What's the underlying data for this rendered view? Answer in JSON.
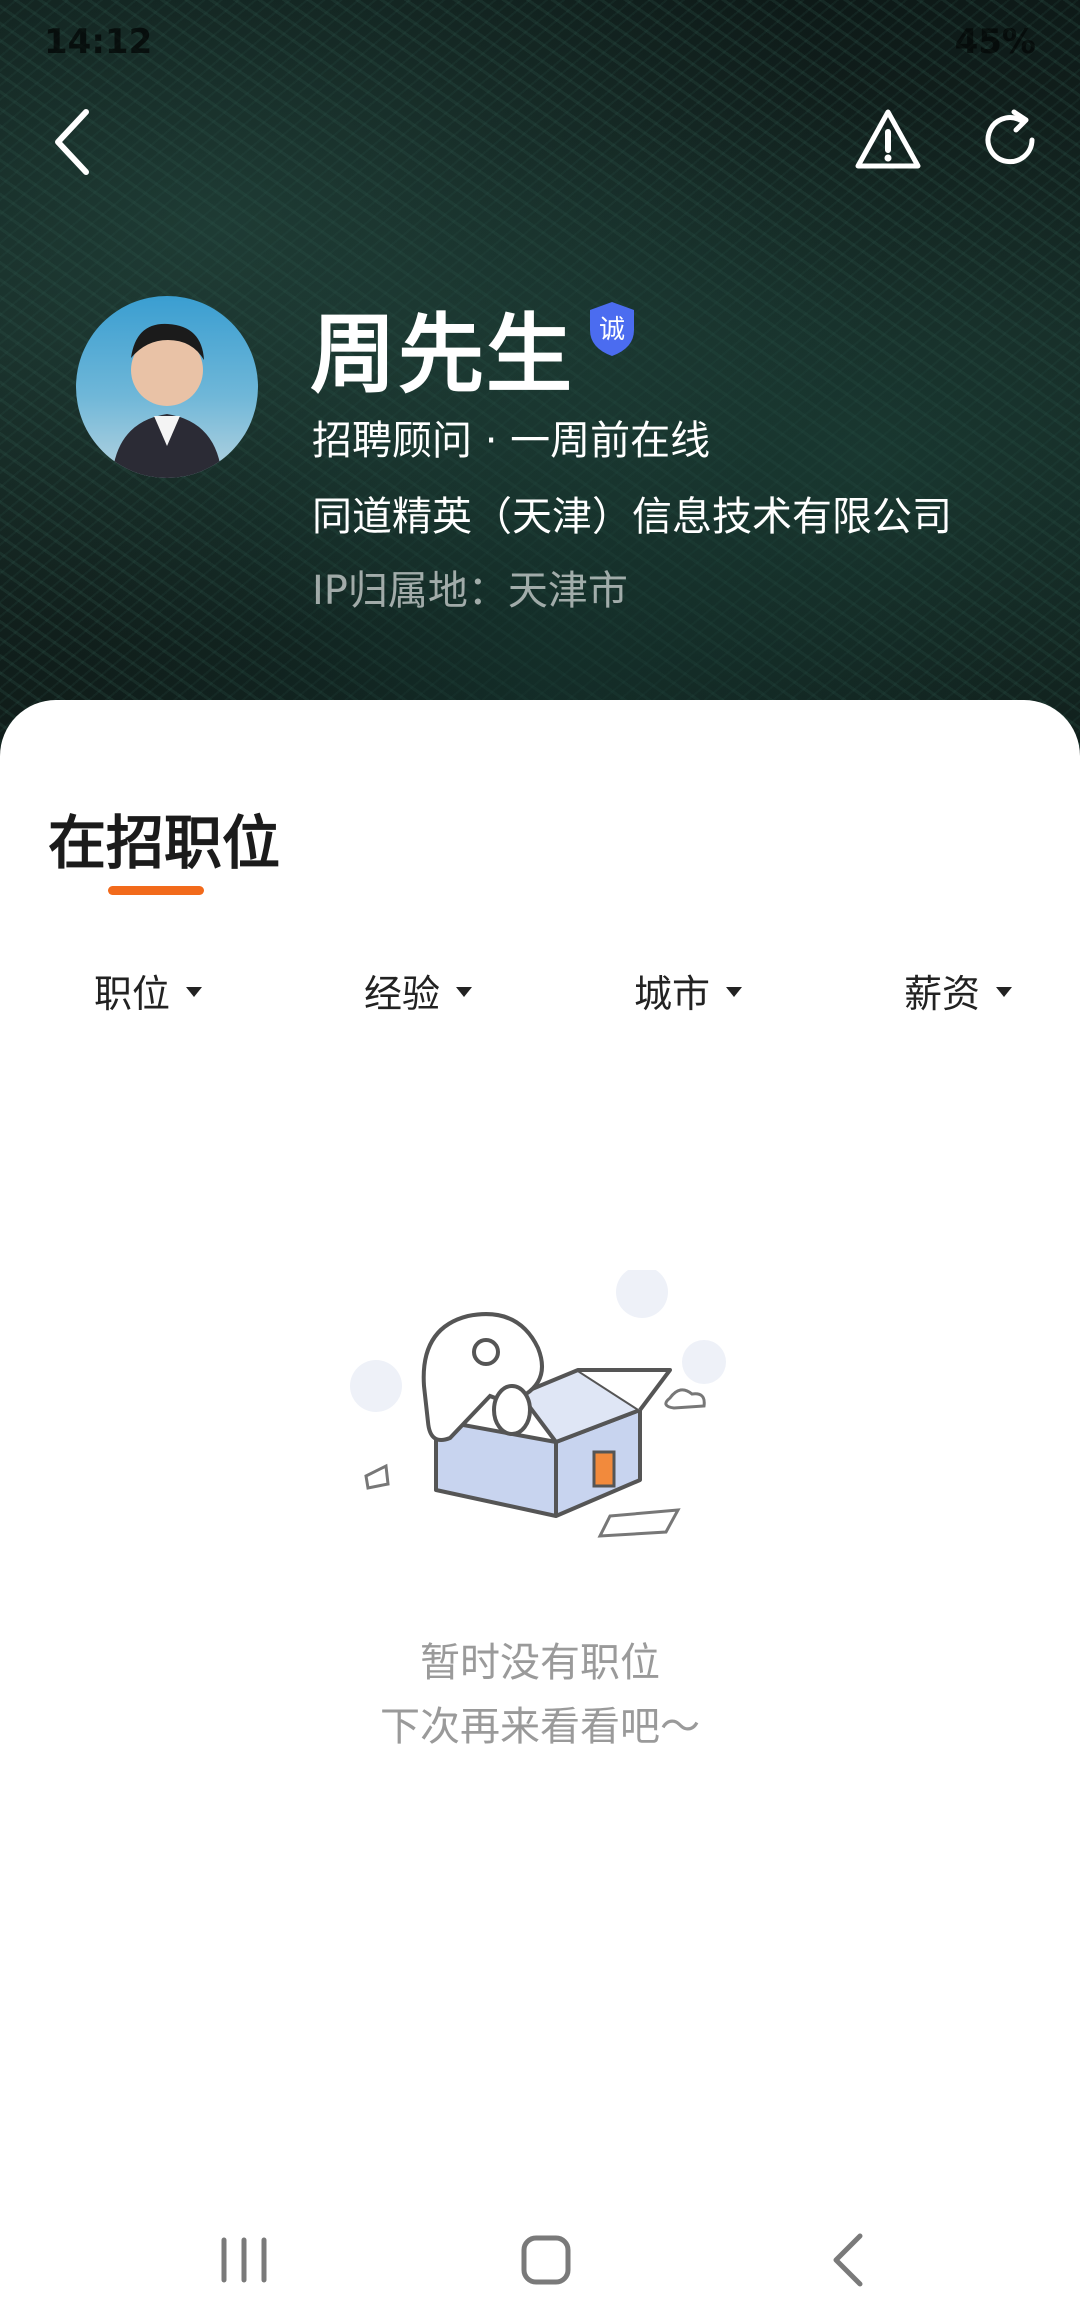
{
  "status_bar": {
    "time": "14:12",
    "battery": "45%"
  },
  "profile": {
    "name": "周先生",
    "badge": "诚",
    "title_line": "招聘顾问 · 一周前在线",
    "company": "同道精英（天津）信息技术有限公司",
    "ip_location": "IP归属地：天津市"
  },
  "tabs": {
    "active": "在招职位"
  },
  "filters": [
    {
      "label": "职位"
    },
    {
      "label": "经验"
    },
    {
      "label": "城市"
    },
    {
      "label": "薪资"
    }
  ],
  "empty_state": {
    "line1": "暂时没有职位",
    "line2": "下次再来看看吧～"
  },
  "colors": {
    "accent": "#f26a1b",
    "badge": "#4b6cf0"
  }
}
